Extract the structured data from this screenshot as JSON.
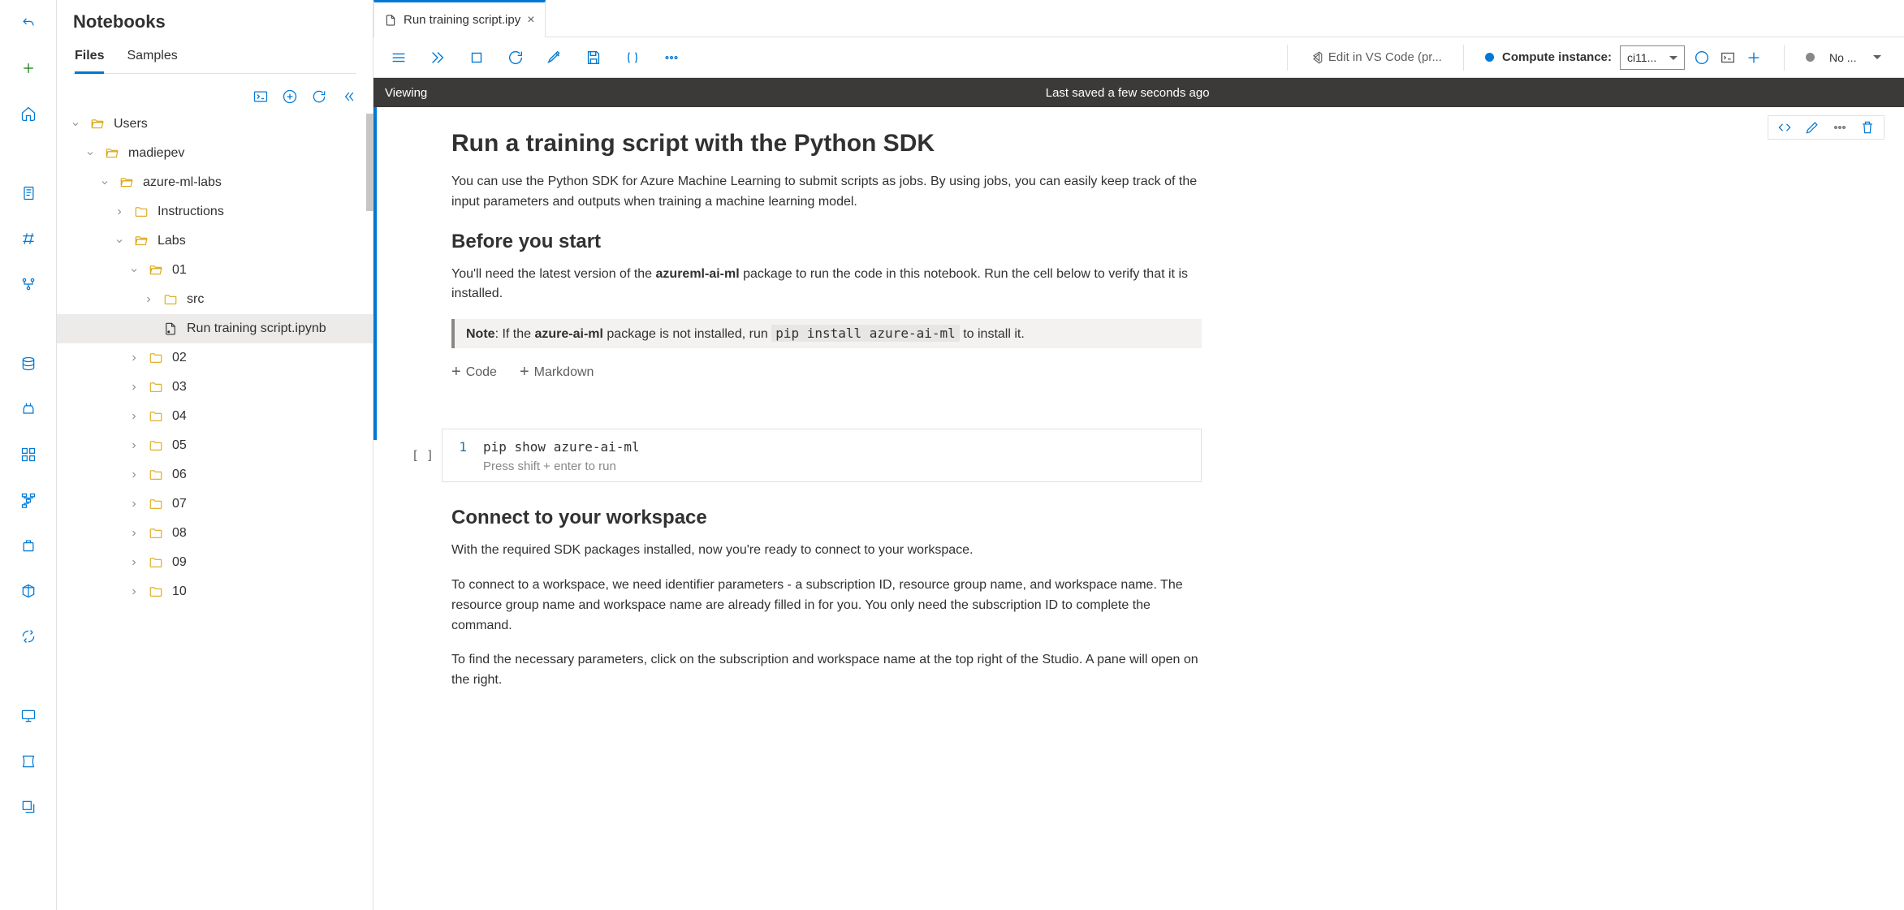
{
  "sidebar": {
    "title": "Notebooks",
    "tabs": [
      "Files",
      "Samples"
    ],
    "activeTab": 0
  },
  "tree": [
    {
      "level": 0,
      "chevron": "down",
      "icon": "folder-open",
      "label": "Users"
    },
    {
      "level": 1,
      "chevron": "down",
      "icon": "folder-open",
      "label": "madiepev"
    },
    {
      "level": 2,
      "chevron": "down",
      "icon": "folder-open",
      "label": "azure-ml-labs"
    },
    {
      "level": 3,
      "chevron": "right",
      "icon": "folder-closed",
      "label": "Instructions"
    },
    {
      "level": 3,
      "chevron": "down",
      "icon": "folder-open",
      "label": "Labs"
    },
    {
      "level": 4,
      "chevron": "down",
      "icon": "folder-open",
      "label": "01"
    },
    {
      "level": 5,
      "chevron": "right",
      "icon": "folder-closed",
      "label": "src"
    },
    {
      "level": 5,
      "chevron": "none",
      "icon": "file",
      "label": "Run training script.ipynb",
      "selected": true
    },
    {
      "level": 4,
      "chevron": "right",
      "icon": "folder-closed",
      "label": "02"
    },
    {
      "level": 4,
      "chevron": "right",
      "icon": "folder-closed",
      "label": "03"
    },
    {
      "level": 4,
      "chevron": "right",
      "icon": "folder-closed",
      "label": "04"
    },
    {
      "level": 4,
      "chevron": "right",
      "icon": "folder-closed",
      "label": "05"
    },
    {
      "level": 4,
      "chevron": "right",
      "icon": "folder-closed",
      "label": "06"
    },
    {
      "level": 4,
      "chevron": "right",
      "icon": "folder-closed",
      "label": "07"
    },
    {
      "level": 4,
      "chevron": "right",
      "icon": "folder-closed",
      "label": "08"
    },
    {
      "level": 4,
      "chevron": "right",
      "icon": "folder-closed",
      "label": "09"
    },
    {
      "level": 4,
      "chevron": "right",
      "icon": "folder-closed",
      "label": "10"
    }
  ],
  "fileTab": {
    "label": "Run training script.ipy"
  },
  "toolbar": {
    "vscode_label": "Edit in VS Code (pr...",
    "compute_label": "Compute instance:",
    "compute_selected": "ci11...",
    "kernel_label": "No ..."
  },
  "status": {
    "mode": "Viewing",
    "saved": "Last saved a few seconds ago"
  },
  "doc": {
    "h1": "Run a training script with the Python SDK",
    "p1": "You can use the Python SDK for Azure Machine Learning to submit scripts as jobs. By using jobs, you can easily keep track of the input parameters and outputs when training a machine learning model.",
    "h2a": "Before you start",
    "p2a": "You'll need the latest version of the ",
    "p2b": "azureml-ai-ml",
    "p2c": " package to run the code in this notebook. Run the cell below to verify that it is installed.",
    "note_pre": "Note",
    "note_a": ": If the ",
    "note_b": "azure-ai-ml",
    "note_c": " package is not installed, run ",
    "note_code": "pip install azure-ai-ml",
    "note_d": " to install it.",
    "add_code": "Code",
    "add_md": "Markdown",
    "code_line": "pip show azure-ai-ml",
    "code_hint": "Press shift + enter to run",
    "exec": "[ ]",
    "h2b": "Connect to your workspace",
    "p3": "With the required SDK packages installed, now you're ready to connect to your workspace.",
    "p4": "To connect to a workspace, we need identifier parameters - a subscription ID, resource group name, and workspace name. The resource group name and workspace name are already filled in for you. You only need the subscription ID to complete the command.",
    "p5": "To find the necessary parameters, click on the subscription and workspace name at the top right of the Studio. A pane will open on the right."
  }
}
